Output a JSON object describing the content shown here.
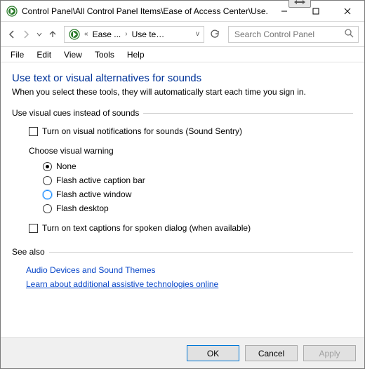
{
  "window": {
    "title": "Control Panel\\All Control Panel Items\\Ease of Access Center\\Use..."
  },
  "breadcrumb": {
    "seg1": "Ease ...",
    "seg2": "Use text ..."
  },
  "search": {
    "placeholder": "Search Control Panel"
  },
  "menu": {
    "file": "File",
    "edit": "Edit",
    "view": "View",
    "tools": "Tools",
    "help": "Help"
  },
  "page": {
    "heading": "Use text or visual alternatives for sounds",
    "subtext": "When you select these tools, they will automatically start each time you sign in.",
    "group1_label": "Use visual cues instead of sounds",
    "chk_sound_sentry": "Turn on visual notifications for sounds (Sound Sentry)",
    "choose_warning": "Choose visual warning",
    "radio_none": "None",
    "radio_caption": "Flash active caption bar",
    "radio_window": "Flash active window",
    "radio_desktop": "Flash desktop",
    "chk_text_captions": "Turn on text captions for spoken dialog (when available)"
  },
  "seealso": {
    "label": "See also",
    "link_audio": "Audio Devices and Sound Themes",
    "link_assist": "Learn about additional assistive technologies online"
  },
  "buttons": {
    "ok": "OK",
    "cancel": "Cancel",
    "apply": "Apply"
  }
}
